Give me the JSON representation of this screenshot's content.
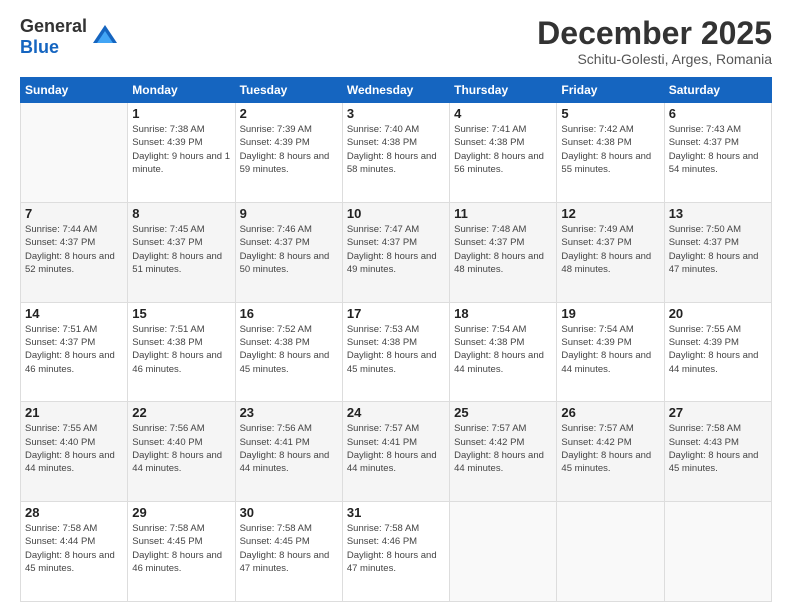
{
  "logo": {
    "general": "General",
    "blue": "Blue"
  },
  "header": {
    "month": "December 2025",
    "location": "Schitu-Golesti, Arges, Romania"
  },
  "weekdays": [
    "Sunday",
    "Monday",
    "Tuesday",
    "Wednesday",
    "Thursday",
    "Friday",
    "Saturday"
  ],
  "weeks": [
    [
      {
        "day": "",
        "sunrise": "",
        "sunset": "",
        "daylight": ""
      },
      {
        "day": "1",
        "sunrise": "7:38 AM",
        "sunset": "4:39 PM",
        "daylight": "9 hours and 1 minute."
      },
      {
        "day": "2",
        "sunrise": "7:39 AM",
        "sunset": "4:39 PM",
        "daylight": "8 hours and 59 minutes."
      },
      {
        "day": "3",
        "sunrise": "7:40 AM",
        "sunset": "4:38 PM",
        "daylight": "8 hours and 58 minutes."
      },
      {
        "day": "4",
        "sunrise": "7:41 AM",
        "sunset": "4:38 PM",
        "daylight": "8 hours and 56 minutes."
      },
      {
        "day": "5",
        "sunrise": "7:42 AM",
        "sunset": "4:38 PM",
        "daylight": "8 hours and 55 minutes."
      },
      {
        "day": "6",
        "sunrise": "7:43 AM",
        "sunset": "4:37 PM",
        "daylight": "8 hours and 54 minutes."
      }
    ],
    [
      {
        "day": "7",
        "sunrise": "7:44 AM",
        "sunset": "4:37 PM",
        "daylight": "8 hours and 52 minutes."
      },
      {
        "day": "8",
        "sunrise": "7:45 AM",
        "sunset": "4:37 PM",
        "daylight": "8 hours and 51 minutes."
      },
      {
        "day": "9",
        "sunrise": "7:46 AM",
        "sunset": "4:37 PM",
        "daylight": "8 hours and 50 minutes."
      },
      {
        "day": "10",
        "sunrise": "7:47 AM",
        "sunset": "4:37 PM",
        "daylight": "8 hours and 49 minutes."
      },
      {
        "day": "11",
        "sunrise": "7:48 AM",
        "sunset": "4:37 PM",
        "daylight": "8 hours and 48 minutes."
      },
      {
        "day": "12",
        "sunrise": "7:49 AM",
        "sunset": "4:37 PM",
        "daylight": "8 hours and 48 minutes."
      },
      {
        "day": "13",
        "sunrise": "7:50 AM",
        "sunset": "4:37 PM",
        "daylight": "8 hours and 47 minutes."
      }
    ],
    [
      {
        "day": "14",
        "sunrise": "7:51 AM",
        "sunset": "4:37 PM",
        "daylight": "8 hours and 46 minutes."
      },
      {
        "day": "15",
        "sunrise": "7:51 AM",
        "sunset": "4:38 PM",
        "daylight": "8 hours and 46 minutes."
      },
      {
        "day": "16",
        "sunrise": "7:52 AM",
        "sunset": "4:38 PM",
        "daylight": "8 hours and 45 minutes."
      },
      {
        "day": "17",
        "sunrise": "7:53 AM",
        "sunset": "4:38 PM",
        "daylight": "8 hours and 45 minutes."
      },
      {
        "day": "18",
        "sunrise": "7:54 AM",
        "sunset": "4:38 PM",
        "daylight": "8 hours and 44 minutes."
      },
      {
        "day": "19",
        "sunrise": "7:54 AM",
        "sunset": "4:39 PM",
        "daylight": "8 hours and 44 minutes."
      },
      {
        "day": "20",
        "sunrise": "7:55 AM",
        "sunset": "4:39 PM",
        "daylight": "8 hours and 44 minutes."
      }
    ],
    [
      {
        "day": "21",
        "sunrise": "7:55 AM",
        "sunset": "4:40 PM",
        "daylight": "8 hours and 44 minutes."
      },
      {
        "day": "22",
        "sunrise": "7:56 AM",
        "sunset": "4:40 PM",
        "daylight": "8 hours and 44 minutes."
      },
      {
        "day": "23",
        "sunrise": "7:56 AM",
        "sunset": "4:41 PM",
        "daylight": "8 hours and 44 minutes."
      },
      {
        "day": "24",
        "sunrise": "7:57 AM",
        "sunset": "4:41 PM",
        "daylight": "8 hours and 44 minutes."
      },
      {
        "day": "25",
        "sunrise": "7:57 AM",
        "sunset": "4:42 PM",
        "daylight": "8 hours and 44 minutes."
      },
      {
        "day": "26",
        "sunrise": "7:57 AM",
        "sunset": "4:42 PM",
        "daylight": "8 hours and 45 minutes."
      },
      {
        "day": "27",
        "sunrise": "7:58 AM",
        "sunset": "4:43 PM",
        "daylight": "8 hours and 45 minutes."
      }
    ],
    [
      {
        "day": "28",
        "sunrise": "7:58 AM",
        "sunset": "4:44 PM",
        "daylight": "8 hours and 45 minutes."
      },
      {
        "day": "29",
        "sunrise": "7:58 AM",
        "sunset": "4:45 PM",
        "daylight": "8 hours and 46 minutes."
      },
      {
        "day": "30",
        "sunrise": "7:58 AM",
        "sunset": "4:45 PM",
        "daylight": "8 hours and 47 minutes."
      },
      {
        "day": "31",
        "sunrise": "7:58 AM",
        "sunset": "4:46 PM",
        "daylight": "8 hours and 47 minutes."
      },
      {
        "day": "",
        "sunrise": "",
        "sunset": "",
        "daylight": ""
      },
      {
        "day": "",
        "sunrise": "",
        "sunset": "",
        "daylight": ""
      },
      {
        "day": "",
        "sunrise": "",
        "sunset": "",
        "daylight": ""
      }
    ]
  ]
}
